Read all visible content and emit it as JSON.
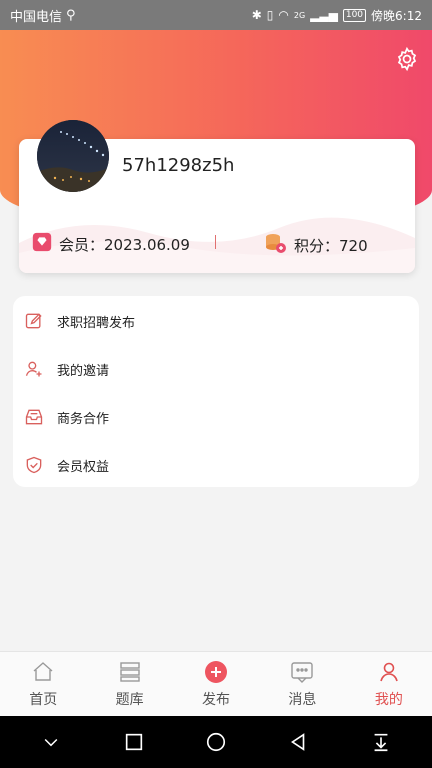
{
  "status_bar": {
    "carrier": "中国电信",
    "usb_icon": "usb-icon",
    "battery": "100",
    "time": "傍晚6:12",
    "network": "2G"
  },
  "header": {
    "settings_icon": "gear-icon"
  },
  "profile": {
    "username": "57h1298z5h",
    "member_label": "会员：2023.06.09",
    "points_label": "积分：720"
  },
  "menu": {
    "items": [
      {
        "label": "求职招聘发布",
        "icon": "edit-icon"
      },
      {
        "label": "我的邀请",
        "icon": "invite-user-icon"
      },
      {
        "label": "商务合作",
        "icon": "inbox-icon"
      },
      {
        "label": "会员权益",
        "icon": "shield-check-icon"
      }
    ]
  },
  "nav": {
    "items": [
      {
        "label": "首页",
        "icon": "home-icon"
      },
      {
        "label": "题库",
        "icon": "list-icon"
      },
      {
        "label": "发布",
        "icon": "plus-circle-icon"
      },
      {
        "label": "消息",
        "icon": "message-icon"
      },
      {
        "label": "我的",
        "icon": "user-icon"
      }
    ],
    "active": "我的"
  },
  "colors": {
    "accent": "#f0496a",
    "gradient_start": "#f88d52",
    "active_nav": "#e05050"
  }
}
